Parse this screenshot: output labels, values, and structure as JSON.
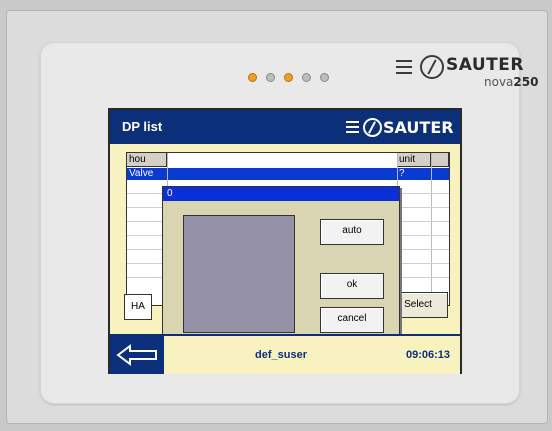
{
  "device": {
    "brand": "SAUTER",
    "model_name": "nova",
    "model_number": "250",
    "leds": [
      "on",
      "off",
      "on",
      "off",
      "off"
    ]
  },
  "screen": {
    "title": "DP list",
    "logo_text": "SAUTER"
  },
  "grid": {
    "col_headers": [
      "hou",
      "unit"
    ],
    "selected_row_text": "Valve",
    "selected_row_right": "?"
  },
  "buttons": {
    "ha": "HA",
    "select": "Select"
  },
  "dialog": {
    "title": "0",
    "auto": "auto",
    "ok": "ok",
    "cancel": "cancel"
  },
  "footer": {
    "user": "def_suser",
    "time": "09:06:13"
  }
}
